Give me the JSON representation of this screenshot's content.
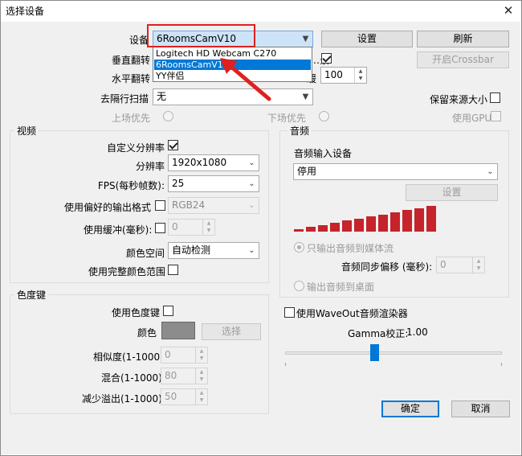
{
  "window": {
    "title": "选择设备",
    "close_glyph": "✕"
  },
  "device": {
    "label": "设备",
    "selected": "6RoomsCamV10",
    "options": [
      "Logitech HD Webcam C270",
      "6RoomsCamV10",
      "YY伴侣"
    ],
    "config_button": "设置",
    "refresh_button": "刷新"
  },
  "flip": {
    "vertical_label": "垂直翻转",
    "horizontal_label": "水平翻转",
    "partial_label": "…景",
    "partial_label2": "…缓",
    "buffer_value": "100",
    "crossbar_button": "开启Crossbar"
  },
  "deinterlace": {
    "label": "去隔行扫描",
    "value": "无",
    "keep_source_label": "保留来源大小"
  },
  "field_order": {
    "top_first": "上场优先",
    "bottom_first": "下场优先",
    "use_gpu": "使用GPU"
  },
  "video": {
    "group_title": "视频",
    "custom_res_label": "自定义分辨率",
    "resolution_label": "分辨率",
    "resolution_value": "1920x1080",
    "fps_label": "FPS(每秒帧数):",
    "fps_value": "25",
    "preferred_format_label": "使用偏好的输出格式",
    "preferred_format_value": "RGB24",
    "buffering_label": "使用缓冲(毫秒):",
    "buffering_value": "0",
    "color_space_label": "颜色空间",
    "color_space_value": "自动检测",
    "full_range_label": "使用完整颜色范围"
  },
  "chroma": {
    "group_title": "色度键",
    "use_label": "使用色度键",
    "color_label": "颜色",
    "color_swatch": "#8c8c8c",
    "select_button": "选择",
    "similarity_label": "相似度(1-1000):",
    "similarity_value": "0",
    "blend_label": "混合(1-1000):",
    "blend_value": "80",
    "spill_label": "减少溢出(1-1000):",
    "spill_value": "50"
  },
  "audio": {
    "group_title": "音频",
    "input_device_label": "音频输入设备",
    "input_device_value": "停用",
    "config_button": "设置",
    "output_stream_only": "只输出音频到媒体流",
    "sync_offset_label": "音频同步偏移 (毫秒):",
    "sync_offset_value": "0",
    "output_desktop": "输出音频到桌面",
    "waveout_label": "使用WaveOut音频渲染器",
    "gamma_label": "Gamma校正:",
    "gamma_value": "1.00",
    "gamma_fraction": 0.41,
    "level_bars": 12,
    "level_color": "#c4242a"
  },
  "buttons": {
    "ok": "确定",
    "cancel": "取消"
  },
  "colors": {
    "accent": "#0078d7",
    "annotation": "#e02020"
  }
}
